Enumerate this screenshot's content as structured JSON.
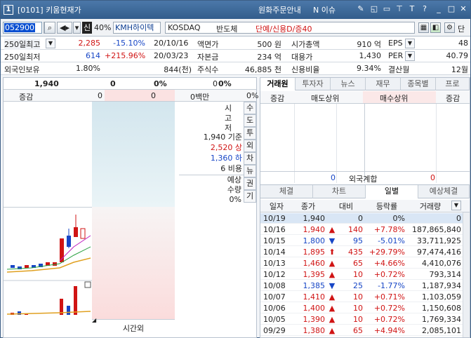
{
  "title": {
    "window_num": "1",
    "text": "[0101] 키움현재가",
    "link1": "원화주문안내",
    "link2": "N 이슈"
  },
  "toolbar": {
    "code": "052900",
    "sin": "신",
    "pct": "40%",
    "name": "KMH하이텍",
    "market": "KOSDAQ",
    "sector": "반도체",
    "credit": "단예/신용D/증40"
  },
  "info": {
    "r1": {
      "l1": "250일최고",
      "v1": "2,285",
      "v2": "-15.10%",
      "v3": "20/10/16",
      "l2": "액면가",
      "v4": "500 원",
      "l3": "시가총액",
      "v5": "910 억",
      "l4": "EPS",
      "v6": "48"
    },
    "r2": {
      "l1": "250일최저",
      "v1": "614",
      "v2": "+215.96%",
      "v3": "20/03/23",
      "l2": "자본금",
      "v4": "234 억",
      "l3": "대용가",
      "v5": "1,430",
      "l4": "PER",
      "v6": "40.79"
    },
    "r3": {
      "l1": "외국인보유",
      "v1": "1.80%",
      "v3": "844(천)",
      "l2": "주식수",
      "v4": "46,885 천",
      "l3": "신용비율",
      "v5": "9.34%",
      "l4": "결산월",
      "v6": "12월"
    }
  },
  "left": {
    "price": "1,940",
    "change": "0",
    "rate": "0%",
    "vol": "0",
    "volpct": "0%",
    "label_change": "증감",
    "z1": "0",
    "z2": "0",
    "mbm": "0백만",
    "mbm_pct": "0%",
    "vert_label": [
      "시",
      "고",
      "저"
    ],
    "base": "1,940 기준",
    "upper": "2,520 상",
    "lower": "1,360 하",
    "ratio": "6 비용",
    "expected": "예상",
    "qty": "수량",
    "qty_pct": "0%",
    "vtabs": [
      "수",
      "도",
      "투",
      "외",
      "차",
      "뉴",
      "권",
      "기"
    ],
    "time": "시간외"
  },
  "right": {
    "tabs": [
      "거래원",
      "투자자",
      "뉴스",
      "재무",
      "종목별",
      "프로"
    ],
    "h1": "증감",
    "h2": "매도상위",
    "h3": "매수상위",
    "h4": "증감",
    "foreign_label": "외국계합",
    "foreign_sell": "0",
    "foreign_buy": "0",
    "tabs2": [
      "체결",
      "차트",
      "일별",
      "예상체결"
    ],
    "cols": [
      "일자",
      "종가",
      "대비",
      "등락률",
      "거래량"
    ],
    "rows": [
      {
        "d": "10/19",
        "p": "1,940",
        "s": "",
        "c": "0",
        "r": "0%",
        "v": "0",
        "cl": ""
      },
      {
        "d": "10/16",
        "p": "1,940",
        "s": "▲",
        "c": "140",
        "r": "+7.78%",
        "v": "187,865,840",
        "cl": "red"
      },
      {
        "d": "10/15",
        "p": "1,800",
        "s": "▼",
        "c": "95",
        "r": "-5.01%",
        "v": "33,711,925",
        "cl": "blue"
      },
      {
        "d": "10/14",
        "p": "1,895",
        "s": "⬆",
        "c": "435",
        "r": "+29.79%",
        "v": "97,474,416",
        "cl": "red"
      },
      {
        "d": "10/13",
        "p": "1,460",
        "s": "▲",
        "c": "65",
        "r": "+4.66%",
        "v": "4,410,076",
        "cl": "red"
      },
      {
        "d": "10/12",
        "p": "1,395",
        "s": "▲",
        "c": "10",
        "r": "+0.72%",
        "v": "793,314",
        "cl": "red"
      },
      {
        "d": "10/08",
        "p": "1,385",
        "s": "▼",
        "c": "25",
        "r": "-1.77%",
        "v": "1,187,934",
        "cl": "blue"
      },
      {
        "d": "10/07",
        "p": "1,410",
        "s": "▲",
        "c": "10",
        "r": "+0.71%",
        "v": "1,103,059",
        "cl": "red"
      },
      {
        "d": "10/06",
        "p": "1,400",
        "s": "▲",
        "c": "10",
        "r": "+0.72%",
        "v": "1,150,608",
        "cl": "red"
      },
      {
        "d": "10/05",
        "p": "1,390",
        "s": "▲",
        "c": "10",
        "r": "+0.72%",
        "v": "1,769,334",
        "cl": "red"
      },
      {
        "d": "09/29",
        "p": "1,380",
        "s": "▲",
        "c": "65",
        "r": "+4.94%",
        "v": "2,085,101",
        "cl": "red"
      }
    ]
  }
}
